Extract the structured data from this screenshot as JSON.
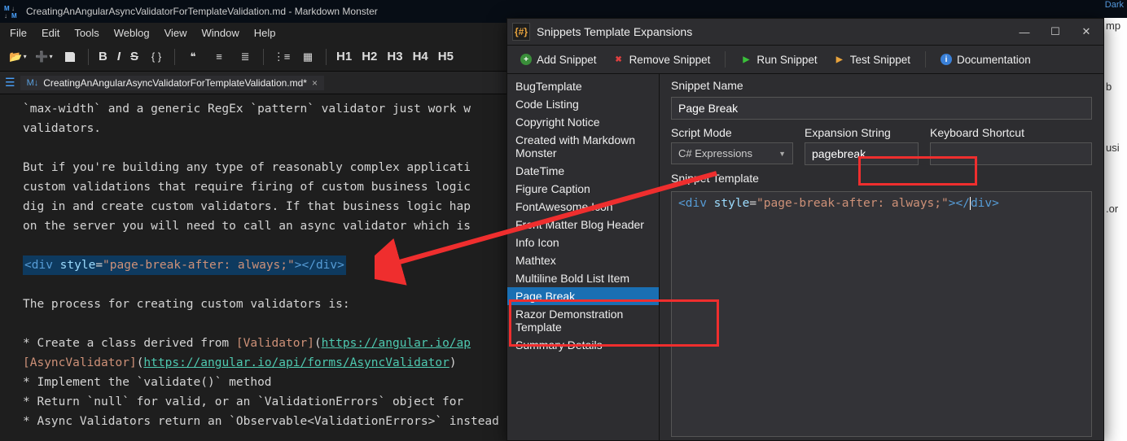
{
  "window": {
    "title": "CreatingAnAngularAsyncValidatorForTemplateValidation.md  - Markdown Monster",
    "dark_label": "Dark"
  },
  "menu": {
    "items": [
      "File",
      "Edit",
      "Tools",
      "Weblog",
      "View",
      "Window",
      "Help"
    ]
  },
  "toolbar": {
    "headings": [
      "H1",
      "H2",
      "H3",
      "H4",
      "H5"
    ],
    "bold": "B",
    "italic": "I",
    "strike": "S"
  },
  "tab": {
    "name": "CreatingAnAngularAsyncValidatorForTemplateValidation.md*",
    "close": "×"
  },
  "editor": {
    "line1": "`max-width` and a generic RegEx `pattern` validator just work w",
    "line2": "validators.",
    "line3": "But if you're building any type of reasonably complex applicati",
    "line4": "custom validations that require firing of custom business logic",
    "line5": "dig in and create custom validators. If that business logic hap",
    "line6": "on the server you will need to call an async validator which is",
    "sel_full": "<div style=\"page-break-after: always;\"></div>",
    "line7": "The process for creating custom validators is:",
    "b1a": "* Create a class derived from ",
    "b1_lt": "[Validator]",
    "b1_lu": "https://angular.io/ap",
    "b2_lt": "[AsyncValidator]",
    "b2_lu": "https://angular.io/api/forms/AsyncValidator",
    "b3": "* Implement the `validate()` method",
    "b4": "* Return `null` for valid, or an `ValidationErrors` object for",
    "b5": "* Async Validators return an `Observable<ValidationErrors>` instead"
  },
  "dialog": {
    "title": "Snippets Template Expansions",
    "toolbar": {
      "add": "Add Snippet",
      "remove": "Remove Snippet",
      "run": "Run Snippet",
      "test": "Test Snippet",
      "docs": "Documentation"
    },
    "list": [
      "BugTemplate",
      "Code Listing",
      "Copyright Notice",
      "Created with Markdown Monster",
      "DateTime",
      "Figure Caption",
      "FontAwesome Icon",
      "Front Matter Blog Header",
      "Info Icon",
      "Mathtex",
      "Multiline Bold List Item",
      "Page Break",
      "Razor Demonstration Template",
      "Summary Details"
    ],
    "form": {
      "name_label": "Snippet Name",
      "name_value": "Page Break",
      "mode_label": "Script Mode",
      "mode_value": "C# Expressions",
      "exp_label": "Expansion String",
      "exp_value": "pagebreak",
      "kbd_label": "Keyboard Shortcut",
      "kbd_value": "",
      "template_label": "Snippet Template",
      "template_code": "<div style=\"page-break-after: always;\"></div>"
    }
  }
}
